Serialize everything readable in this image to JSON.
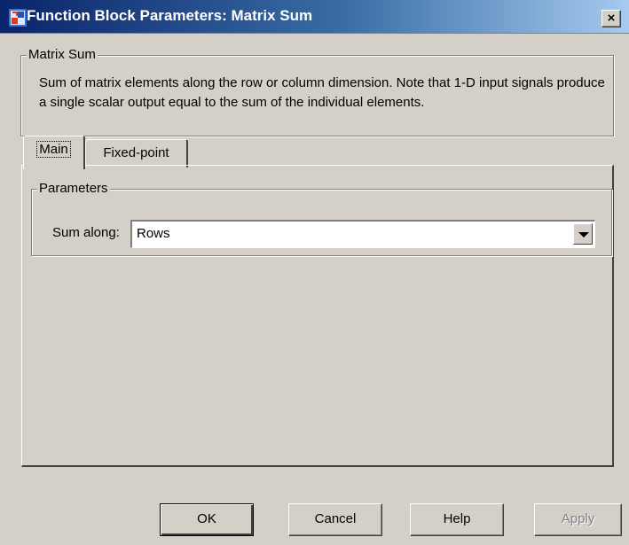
{
  "window": {
    "title": "Function Block Parameters: Matrix Sum",
    "close_label": "×"
  },
  "block": {
    "group_title": "Matrix Sum",
    "description": "Sum of matrix elements along the row or column dimension. Note that 1-D input signals produce a single scalar output equal to the sum of the individual elements."
  },
  "tabs": [
    {
      "label": "Main",
      "active": true
    },
    {
      "label": "Fixed-point",
      "active": false
    }
  ],
  "parameters": {
    "group_title": "Parameters",
    "sum_along": {
      "label": "Sum along:",
      "value": "Rows"
    }
  },
  "buttons": {
    "ok": "OK",
    "cancel": "Cancel",
    "help": "Help",
    "apply": "Apply"
  },
  "icons": {
    "app": "simulink-block-icon",
    "close": "close-icon",
    "dropdown": "chevron-down-icon"
  },
  "colors": {
    "titlebar_start": "#0a246a",
    "titlebar_end": "#a6caf0",
    "dialog_bg": "#d4d0c8",
    "disabled_text": "#808080"
  }
}
